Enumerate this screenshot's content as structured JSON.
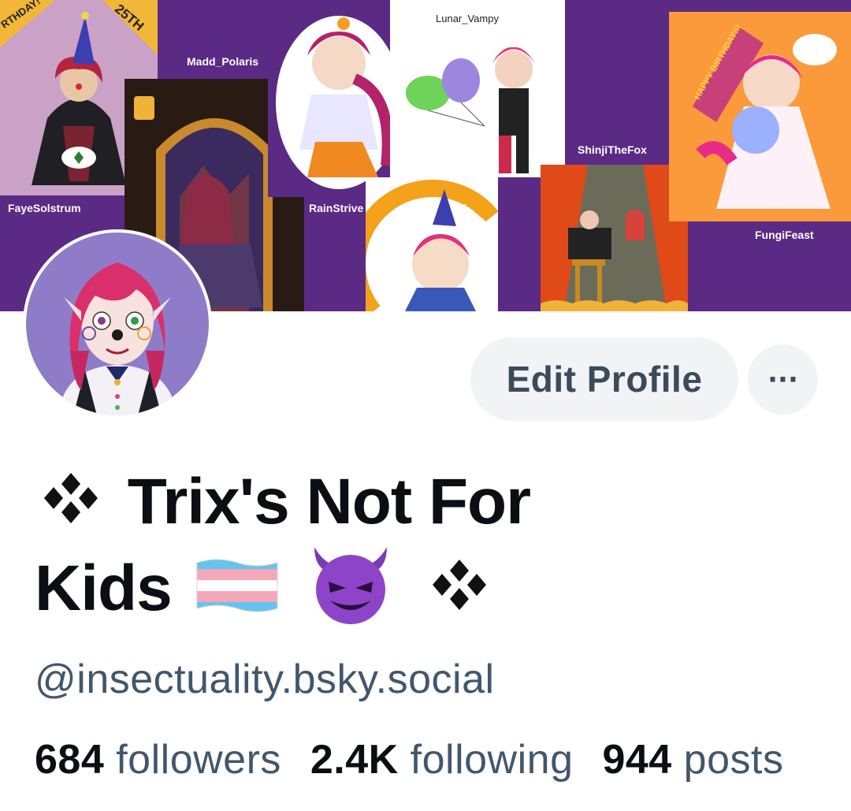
{
  "banner": {
    "artists": [
      {
        "name": "FayeSolstrum"
      },
      {
        "name": "Madd_Polaris"
      },
      {
        "name": "RainStrive"
      },
      {
        "name": "Lunar_Vampy"
      },
      {
        "name": "ShinjiTheFox"
      },
      {
        "name": "FungiFeast"
      }
    ],
    "art_texts": {
      "birthday_25th": "25TH",
      "birthday_left": "RTHDAY!",
      "happy_birthday": "HAPPY BIRTHDAY!!!",
      "happy": "HAPPY",
      "birthday": "BIRTHDAY"
    }
  },
  "profile": {
    "display_name_part1": "Trix's Not For",
    "display_name_part2": "Kids",
    "handle": "@insectuality.bsky.social",
    "actions": {
      "edit_label": "Edit Profile",
      "more_label": "···"
    },
    "stats": {
      "followers_count": "684",
      "followers_label": "followers",
      "following_count": "2.4K",
      "following_label": "following",
      "posts_count": "944",
      "posts_label": "posts"
    }
  },
  "colors": {
    "banner_purple": "#5a2a85",
    "button_bg": "#f1f3f5",
    "button_text": "#3b4b5c",
    "muted_text": "#42576c",
    "primary_text": "#0b0f14"
  },
  "icons": {
    "sparkle": "four-diamond-sparkle-icon",
    "flag": "transgender-flag-icon",
    "emoji": "smiling-devil-icon"
  }
}
